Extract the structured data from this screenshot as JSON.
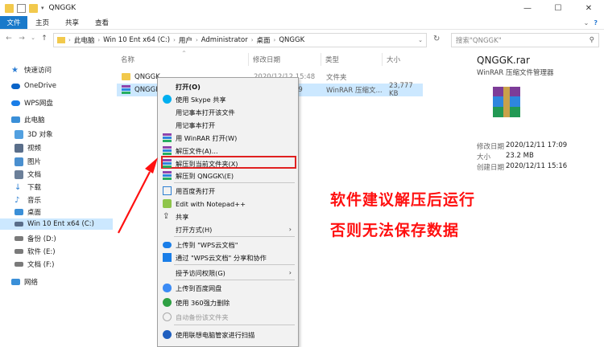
{
  "window": {
    "title": "QNGGK",
    "controls": {
      "minimize": "—",
      "maximize": "☐",
      "close": "✕"
    }
  },
  "ribbon": {
    "file_tab": "文件",
    "tabs": [
      "主页",
      "共享",
      "查看"
    ],
    "help": "?"
  },
  "address": {
    "crumbs": [
      "此电脑",
      "Win 10 Ent x64 (C:)",
      "用户",
      "Administrator",
      "桌面",
      "QNGGK"
    ],
    "search_placeholder": "搜索\"QNGGK\""
  },
  "nav": {
    "items": [
      {
        "label": "快速访问",
        "icon": "star-icon",
        "color": "#2b7cd3"
      },
      {
        "label": "OneDrive",
        "icon": "cloud-icon",
        "color": "#0a64c8"
      },
      {
        "label": "WPS网盘",
        "icon": "wps-cloud-icon",
        "color": "#1a7ee8"
      },
      {
        "label": "此电脑",
        "icon": "computer-icon",
        "color": "#3a8fd8"
      },
      {
        "label": "3D 对象",
        "icon": "cube-icon",
        "color": "#52a0e0"
      },
      {
        "label": "视频",
        "icon": "video-icon",
        "color": "#5a6e8a"
      },
      {
        "label": "图片",
        "icon": "picture-icon",
        "color": "#4a8fcf"
      },
      {
        "label": "文档",
        "icon": "document-icon",
        "color": "#6b7f99"
      },
      {
        "label": "下载",
        "icon": "download-icon",
        "color": "#2d7fd2"
      },
      {
        "label": "音乐",
        "icon": "music-icon",
        "color": "#2d7fd2"
      },
      {
        "label": "桌面",
        "icon": "desktop-icon",
        "color": "#3a8fd8"
      },
      {
        "label": "Win 10 Ent x64 (C:)",
        "icon": "drive-icon",
        "color": "#5a6e8a"
      },
      {
        "label": "备份 (D:)",
        "icon": "drive-icon",
        "color": "#7a7a7a"
      },
      {
        "label": "软件 (E:)",
        "icon": "drive-icon",
        "color": "#7a7a7a"
      },
      {
        "label": "文档 (F:)",
        "icon": "drive-icon",
        "color": "#7a7a7a"
      },
      {
        "label": "网络",
        "icon": "network-icon",
        "color": "#3a8fd8"
      }
    ]
  },
  "columns": {
    "name": "名称",
    "modified": "修改日期",
    "type": "类型",
    "size": "大小"
  },
  "files": [
    {
      "name": "QNGGK",
      "modified": "2020/12/12 15:48",
      "type": "文件夹",
      "size": "",
      "icon": "folder-icon"
    },
    {
      "name": "QNGGK.",
      "modified": "09",
      "type": "WinRAR 压缩文...",
      "size": "23,777 KB",
      "icon": "winrar-icon"
    }
  ],
  "details": {
    "name": "QNGGK.rar",
    "type": "WinRAR 压缩文件管理器",
    "rows": [
      {
        "k": "修改日期",
        "v": "2020/12/11 17:09"
      },
      {
        "k": "大小",
        "v": "23.2 MB"
      },
      {
        "k": "创建日期",
        "v": "2020/12/11 15:16"
      }
    ]
  },
  "context_menu": {
    "items": [
      {
        "label": "打开(O)",
        "icon": "",
        "bold": true
      },
      {
        "label": "使用 Skype 共享",
        "icon": "skype-icon"
      },
      {
        "label": "用记事本打开该文件",
        "icon": ""
      },
      {
        "label": "用记事本打开",
        "icon": ""
      },
      {
        "label": "用 WinRAR 打开(W)",
        "icon": "winrar-icon"
      },
      {
        "label": "解压文件(A)...",
        "icon": "winrar-icon"
      },
      {
        "label": "解压到当前文件夹(X)",
        "icon": "winrar-icon"
      },
      {
        "label": "解压到 QNGGK\\(E)",
        "icon": "winrar-icon"
      },
      {
        "label": "用百度秀打开",
        "icon": "baidu-icon"
      },
      {
        "label": "Edit with Notepad++",
        "icon": "notepadpp-icon"
      },
      {
        "label": "共享",
        "icon": "share-icon"
      },
      {
        "label": "打开方式(H)",
        "icon": "",
        "arrow": "›"
      },
      {
        "label": "上传到 \"WPS云文档\"",
        "icon": "wps-upload-icon"
      },
      {
        "label": "通过 \"WPS云文档\" 分享和协作",
        "icon": "wps-share-icon"
      },
      {
        "label": "授予访问权限(G)",
        "icon": "",
        "arrow": "›"
      },
      {
        "label": "上传到百度网盘",
        "icon": "baidu-pan-icon"
      },
      {
        "label": "使用 360强力删除",
        "icon": "360-icon"
      },
      {
        "label": "自动备份该文件夹",
        "icon": "backup-icon",
        "disabled": true
      },
      {
        "label": "使用联想电脑管家进行扫描",
        "icon": "lenovo-icon"
      }
    ]
  },
  "annotation": {
    "line1": "软件建议解压后运行",
    "line2": "否则无法保存数据",
    "color": "#ff1010"
  }
}
